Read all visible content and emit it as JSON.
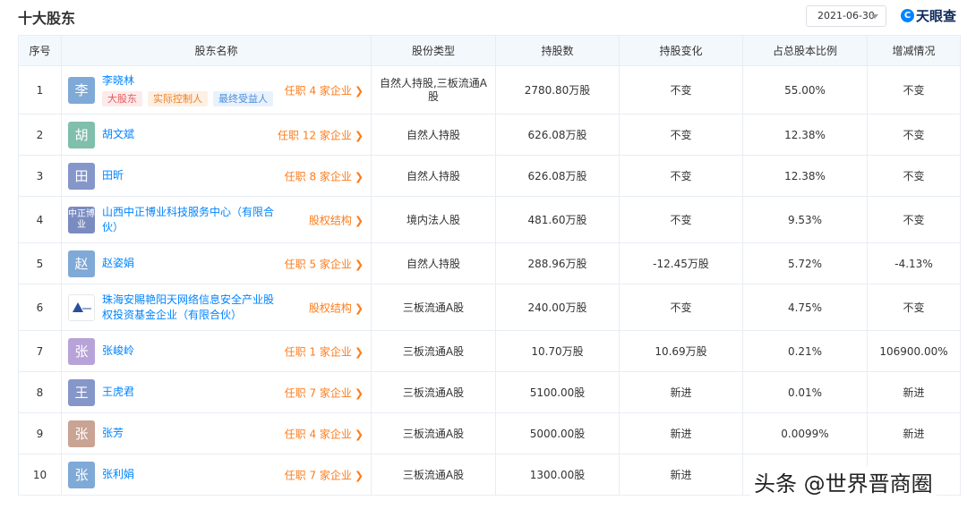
{
  "header": {
    "title": "十大股东",
    "date_value": "2021-06-30",
    "brand_icon": "C",
    "brand_text": "天眼查"
  },
  "table": {
    "columns": [
      "序号",
      "股东名称",
      "股份类型",
      "持股数",
      "持股变化",
      "占总股本比例",
      "增减情况"
    ],
    "rows": [
      {
        "index": "1",
        "avatar": "李",
        "avatar_color": "#7fa9d6",
        "name": "李晓林",
        "tags": [
          "大股东",
          "实际控制人",
          "最终受益人"
        ],
        "link": "任职 4 家企业",
        "type": "自然人持股,三板流通A股",
        "shares": "2780.80万股",
        "change": "不变",
        "ratio": "55.00%",
        "delta": "不变"
      },
      {
        "index": "2",
        "avatar": "胡",
        "avatar_color": "#7fbfab",
        "name": "胡文斌",
        "link": "任职 12 家企业",
        "type": "自然人持股",
        "shares": "626.08万股",
        "change": "不变",
        "ratio": "12.38%",
        "delta": "不变"
      },
      {
        "index": "3",
        "avatar": "田",
        "avatar_color": "#8596c9",
        "name": "田昕",
        "link": "任职 8 家企业",
        "type": "自然人持股",
        "shares": "626.08万股",
        "change": "不变",
        "ratio": "12.38%",
        "delta": "不变"
      },
      {
        "index": "4",
        "avatar": "中正博业",
        "avatar_color": "#7a8bc0",
        "name": "山西中正博业科技服务中心（有限合伙）",
        "link": "股权结构",
        "type": "境内法人股",
        "shares": "481.60万股",
        "change": "不变",
        "ratio": "9.53%",
        "delta": "不变"
      },
      {
        "index": "5",
        "avatar": "赵",
        "avatar_color": "#7fa9d6",
        "name": "赵姿娟",
        "link": "任职 5 家企业",
        "type": "自然人持股",
        "shares": "288.96万股",
        "change": "-12.45万股",
        "ratio": "5.72%",
        "delta": "-4.13%"
      },
      {
        "index": "6",
        "avatar": "",
        "avatar_color": "#ffffff",
        "name": "珠海安賜艳阳天网络信息安全产业股权投资基金企业（有限合伙）",
        "link": "股权结构",
        "type": "三板流通A股",
        "shares": "240.00万股",
        "change": "不变",
        "ratio": "4.75%",
        "delta": "不变"
      },
      {
        "index": "7",
        "avatar": "张",
        "avatar_color": "#b8a3d9",
        "name": "张峻岭",
        "link": "任职 1 家企业",
        "type": "三板流通A股",
        "shares": "10.70万股",
        "change": "10.69万股",
        "ratio": "0.21%",
        "delta": "106900.00%"
      },
      {
        "index": "8",
        "avatar": "王",
        "avatar_color": "#8596c9",
        "name": "王虎君",
        "link": "任职 7 家企业",
        "type": "三板流通A股",
        "shares": "5100.00股",
        "change": "新进",
        "ratio": "0.01%",
        "delta": "新进"
      },
      {
        "index": "9",
        "avatar": "张",
        "avatar_color": "#c9a393",
        "name": "张芳",
        "link": "任职 4 家企业",
        "type": "三板流通A股",
        "shares": "5000.00股",
        "change": "新进",
        "ratio": "0.0099%",
        "delta": "新进"
      },
      {
        "index": "10",
        "avatar": "张",
        "avatar_color": "#7fa9d6",
        "name": "张利娟",
        "link": "任职 7 家企业",
        "type": "三板流通A股",
        "shares": "1300.00股",
        "change": "新进",
        "ratio": "",
        "delta": ""
      }
    ]
  },
  "watermark": "头条 @世界晋商圈",
  "colors": {
    "link_blue": "#0084ff",
    "link_orange": "#ff7b1a",
    "header_bg": "#f3f8fd"
  }
}
